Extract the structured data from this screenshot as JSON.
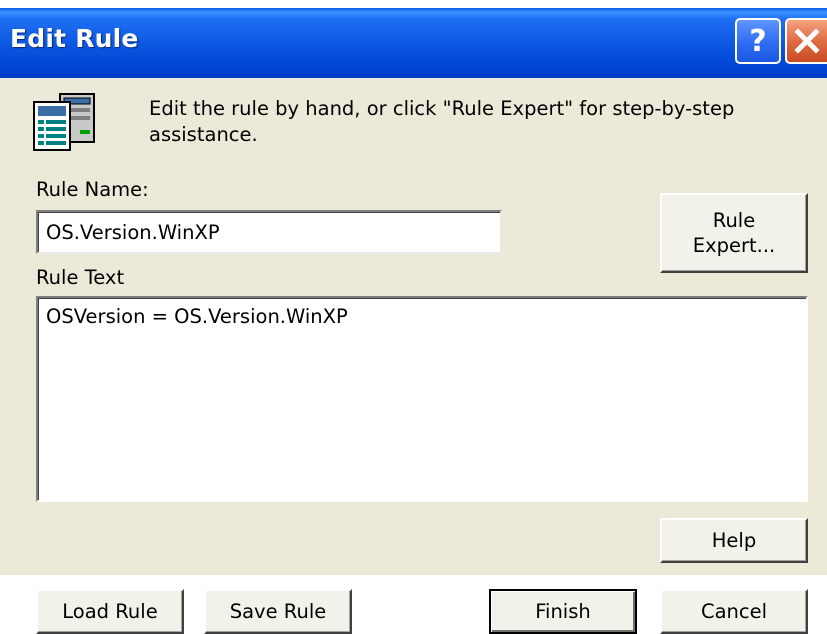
{
  "window": {
    "title": "Edit Rule",
    "help_glyph": "?"
  },
  "description": "Edit the rule by hand, or click \"Rule Expert\" for step-by-step assistance.",
  "rule_name": {
    "label": "Rule Name:",
    "value": "OS.Version.WinXP"
  },
  "rule_text": {
    "label": "Rule Text",
    "value": "OSVersion = OS.Version.WinXP"
  },
  "buttons": {
    "rule_expert_line1": "Rule",
    "rule_expert_line2": "Expert...",
    "help": "Help",
    "load_rule": "Load Rule",
    "save_rule": "Save Rule",
    "finish": "Finish",
    "cancel": "Cancel"
  },
  "icons": {
    "app": "computer-document-icon",
    "help": "help-icon",
    "close": "close-icon"
  }
}
